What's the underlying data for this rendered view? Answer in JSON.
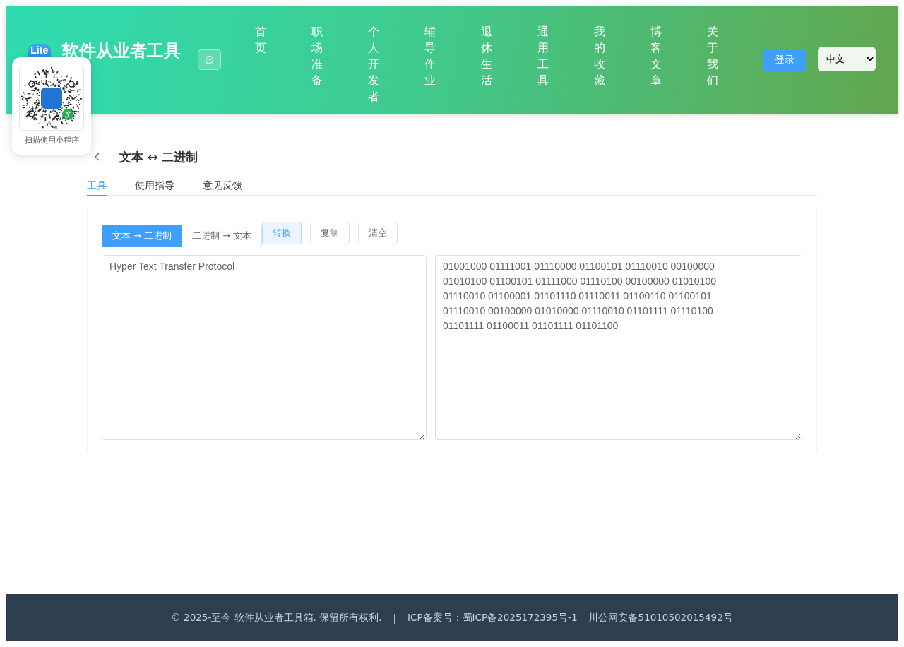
{
  "header": {
    "logo_text": "Lite",
    "site_title": "软件从业者工具",
    "nav": [
      {
        "label": "首页"
      },
      {
        "label": "职场准备"
      },
      {
        "label": "个人开发者"
      },
      {
        "label": "辅导作业"
      },
      {
        "label": "退休生活"
      },
      {
        "label": "通用工具"
      },
      {
        "label": "我的收藏"
      },
      {
        "label": "博客文章"
      },
      {
        "label": "关于我们"
      }
    ],
    "login": "登录",
    "language": "中文"
  },
  "qr_popup": {
    "caption": "扫描使用小程序"
  },
  "page": {
    "title": "文本 ↔ 二进制",
    "tabs": [
      {
        "label": "工具",
        "selected": true
      },
      {
        "label": "使用指导",
        "selected": false
      },
      {
        "label": "意见反馈",
        "selected": false
      }
    ],
    "modes": [
      {
        "label": "文本 → 二进制",
        "selected": true
      },
      {
        "label": "二进制 → 文本",
        "selected": false
      }
    ],
    "actions": [
      {
        "label": "转换",
        "kind": "primary"
      },
      {
        "label": "复制",
        "kind": "plain"
      },
      {
        "label": "清空",
        "kind": "plain"
      }
    ],
    "input": "Hyper Text Transfer Protocol",
    "output": "01001000 01111001 01110000 01100101 01110010 00100000 01010100 01100101 01111000 01110100 00100000 01010100 01110010 01100001 01101110 01110011 01100110 01100101 01110010 00100000 01010000 01110010 01101111 01110100 01101111 01100011 01101111 01101100"
  },
  "footer": {
    "copyright": "© 2025-至今 软件从业者工具箱. 保留所有权利.",
    "separator": "|",
    "icp": "ICP备案号：蜀ICP备2025172395号-1",
    "police": "川公网安备51010502015492号"
  }
}
